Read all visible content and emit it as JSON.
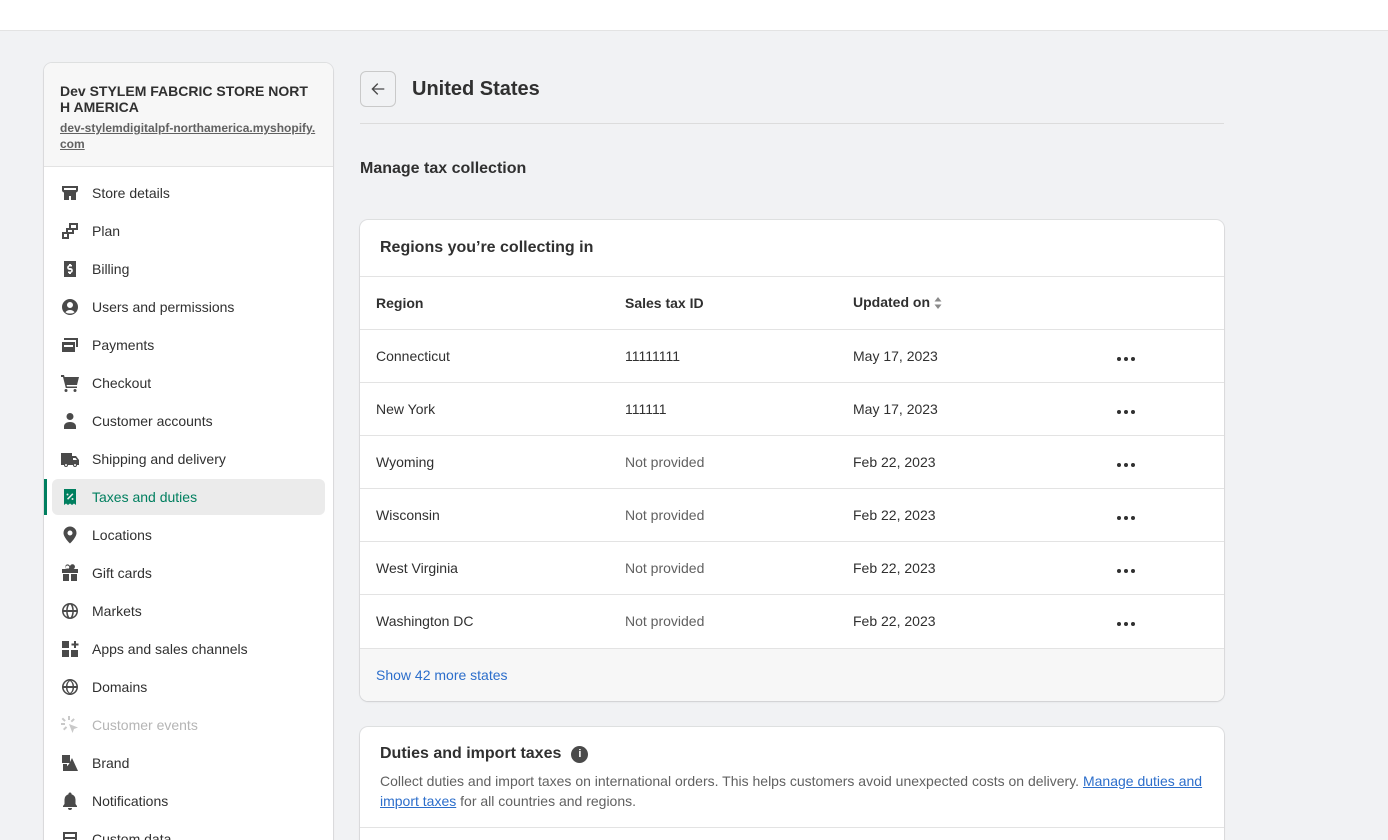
{
  "store": {
    "name": "Dev STYLEM FABCRIC STORE NORTH AMERICA",
    "url": "dev-stylemdigitalpf-northamerica.myshopify.com"
  },
  "sidebar": {
    "items": [
      {
        "label": "Store details",
        "icon": "store-icon"
      },
      {
        "label": "Plan",
        "icon": "plan-icon"
      },
      {
        "label": "Billing",
        "icon": "billing-icon"
      },
      {
        "label": "Users and permissions",
        "icon": "user-circle-icon"
      },
      {
        "label": "Payments",
        "icon": "payments-icon"
      },
      {
        "label": "Checkout",
        "icon": "cart-icon"
      },
      {
        "label": "Customer accounts",
        "icon": "person-icon"
      },
      {
        "label": "Shipping and delivery",
        "icon": "truck-icon"
      },
      {
        "label": "Taxes and duties",
        "icon": "tax-receipt-icon"
      },
      {
        "label": "Locations",
        "icon": "location-pin-icon"
      },
      {
        "label": "Gift cards",
        "icon": "gift-icon"
      },
      {
        "label": "Markets",
        "icon": "globe-markets-icon"
      },
      {
        "label": "Apps and sales channels",
        "icon": "apps-icon"
      },
      {
        "label": "Domains",
        "icon": "globe-icon"
      },
      {
        "label": "Customer events",
        "icon": "cursor-click-icon"
      },
      {
        "label": "Brand",
        "icon": "brand-icon"
      },
      {
        "label": "Notifications",
        "icon": "bell-icon"
      },
      {
        "label": "Custom data",
        "icon": "custom-data-icon"
      }
    ],
    "active_index": 8,
    "disabled_index": 14
  },
  "header": {
    "title": "United States"
  },
  "section": {
    "title": "Manage tax collection"
  },
  "regions": {
    "title": "Regions you’re collecting in",
    "columns": [
      "Region",
      "Sales tax ID",
      "Updated on"
    ],
    "rows": [
      {
        "region": "Connecticut",
        "tax_id": "11111111",
        "updated": "May 17, 2023"
      },
      {
        "region": "New York",
        "tax_id": "111111",
        "updated": "May 17, 2023"
      },
      {
        "region": "Wyoming",
        "tax_id": "Not provided",
        "updated": "Feb 22, 2023"
      },
      {
        "region": "Wisconsin",
        "tax_id": "Not provided",
        "updated": "Feb 22, 2023"
      },
      {
        "region": "West Virginia",
        "tax_id": "Not provided",
        "updated": "Feb 22, 2023"
      },
      {
        "region": "Washington DC",
        "tax_id": "Not provided",
        "updated": "Feb 22, 2023"
      }
    ],
    "more_link": "Show 42 more states"
  },
  "duties": {
    "title": "Duties and import taxes",
    "text_before": "Collect duties and import taxes on international orders. This helps customers avoid unexpected costs on delivery. ",
    "link": "Manage duties and import taxes",
    "text_after": " for all countries and regions."
  },
  "colors": {
    "accent": "#007f5f",
    "link": "#2c6ecb",
    "background": "#f1f2f4"
  }
}
